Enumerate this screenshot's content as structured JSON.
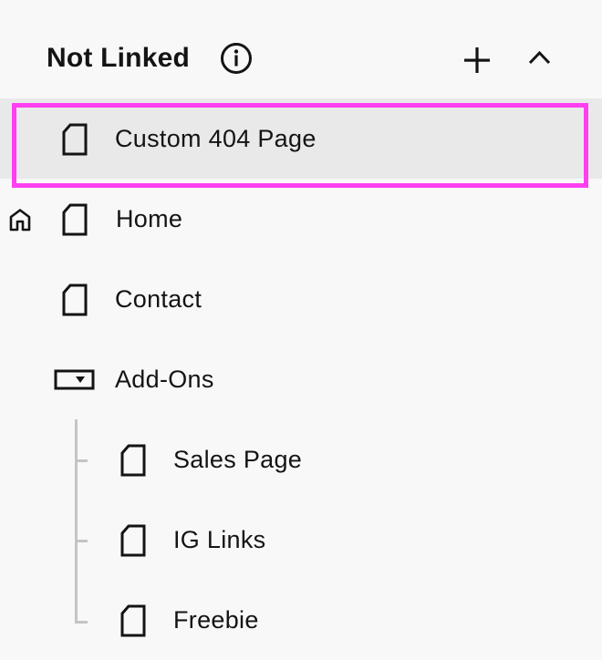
{
  "header": {
    "title": "Not Linked",
    "info_icon": "info-circle-icon",
    "add_icon": "plus-icon",
    "collapse_icon": "chevron-up-icon"
  },
  "pages": [
    {
      "label": "Custom 404 Page",
      "icon": "page-icon",
      "selected": true
    },
    {
      "label": "Home",
      "icon": "page-icon",
      "is_homepage": true
    },
    {
      "label": "Contact",
      "icon": "page-icon"
    },
    {
      "label": "Add-Ons",
      "icon": "dropdown-folder-icon",
      "children": [
        {
          "label": "Sales Page",
          "icon": "page-icon"
        },
        {
          "label": "IG Links",
          "icon": "page-icon"
        },
        {
          "label": "Freebie",
          "icon": "page-icon"
        }
      ]
    }
  ],
  "colors": {
    "background": "#f8f8f8",
    "selected_row": "#e9e9e9",
    "highlight_border": "#ff3ff0",
    "tree_line": "#c4c4c4",
    "text": "#141414"
  }
}
